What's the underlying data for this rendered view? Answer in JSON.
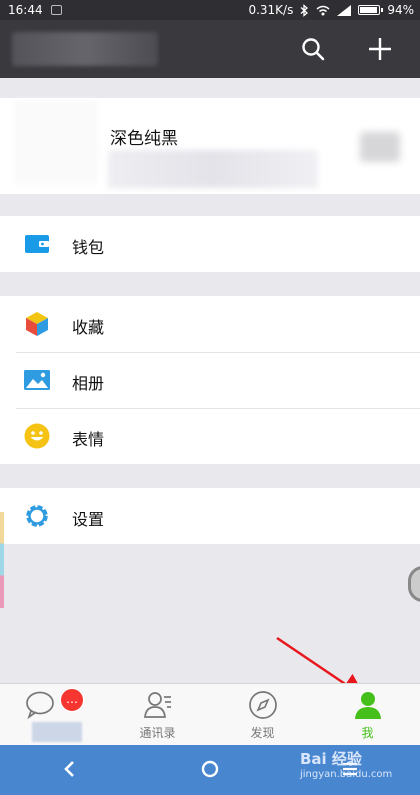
{
  "status_bar": {
    "time": "16:44",
    "speed": "0.31K/s",
    "battery": "94%",
    "battery_level": 0.94
  },
  "profile": {
    "name": "深色纯黑"
  },
  "menu": {
    "wallet": "钱包",
    "favorites": "收藏",
    "album": "相册",
    "stickers": "表情",
    "settings": "设置"
  },
  "tabs": {
    "chats": {
      "badge": "…"
    },
    "contacts": "通讯录",
    "discover": "发现",
    "me": "我"
  },
  "watermark": {
    "brand": "Bai 经验",
    "url": "jingyan.baidu.com"
  },
  "colors": {
    "accent_green": "#45c01a",
    "badge_red": "#f43530",
    "wallet_blue": "#1a9be8",
    "nav_blue": "#4886d0"
  }
}
